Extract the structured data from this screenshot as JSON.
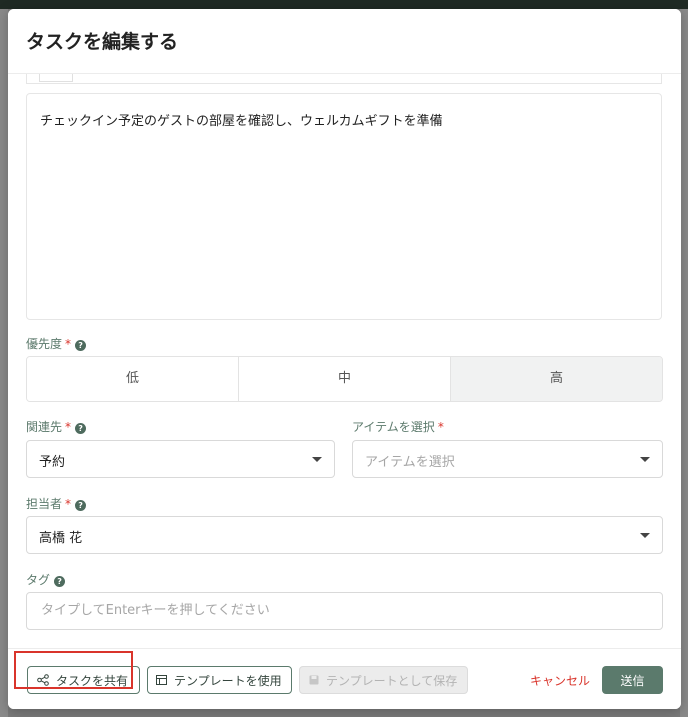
{
  "modal": {
    "title": "タスクを編集する"
  },
  "editor": {
    "content": "チェックイン予定のゲストの部屋を確認し、ウェルカムギフトを準備"
  },
  "priority": {
    "label": "優先度",
    "required_mark": "*",
    "options": [
      "低",
      "中",
      "高"
    ],
    "selected": "高"
  },
  "related": {
    "label": "関連先",
    "required_mark": "*",
    "value": "予約"
  },
  "item_select": {
    "label": "アイテムを選択",
    "required_mark": "*",
    "placeholder": "アイテムを選択"
  },
  "assignee": {
    "label": "担当者",
    "required_mark": "*",
    "value": "高橋 花"
  },
  "tags": {
    "label": "タグ",
    "placeholder": "タイプしてEnterキーを押してください"
  },
  "help_glyph": "?",
  "footer": {
    "share_label": "タスクを共有",
    "use_template_label": "テンプレートを使用",
    "save_template_label": "テンプレートとして保存",
    "cancel_label": "キャンセル",
    "submit_label": "送信"
  },
  "colors": {
    "accent": "#5b7a6c",
    "required": "#d9342b",
    "cancel": "#d9342b"
  }
}
